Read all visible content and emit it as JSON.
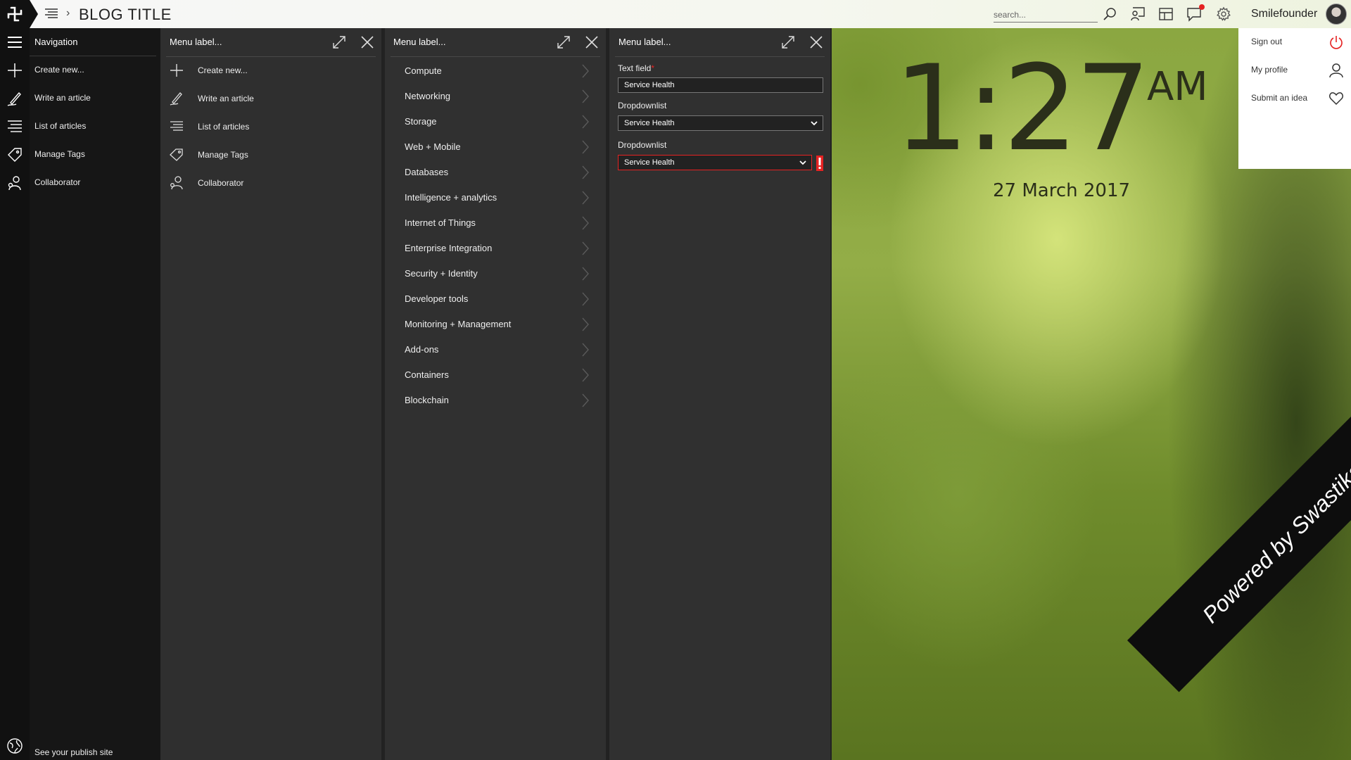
{
  "app": {
    "blog_title": "BLOG TITLE",
    "username": "Smilefounder"
  },
  "search": {
    "placeholder": "search..."
  },
  "colors": {
    "topbar_bg": "#f7f7f7",
    "rail_bg": "#111111",
    "panel_bg": "#303030",
    "error": "#e52222",
    "clock_text": "#2b2f1a"
  },
  "navigation": {
    "title": "Navigation",
    "items": [
      {
        "label": "Create new...",
        "icon": "plus-icon"
      },
      {
        "label": "Write an article",
        "icon": "pen-icon"
      },
      {
        "label": "List of articles",
        "icon": "list-icon"
      },
      {
        "label": "Manage Tags",
        "icon": "tag-icon"
      },
      {
        "label": "Collaborator",
        "icon": "collaborator-icon"
      }
    ],
    "publish_label": "See your publish site"
  },
  "panel1": {
    "title": "Menu label...",
    "items": [
      {
        "label": "Create new...",
        "icon": "plus-icon"
      },
      {
        "label": "Write an article",
        "icon": "pen-icon"
      },
      {
        "label": "List of articles",
        "icon": "list-icon"
      },
      {
        "label": "Manage Tags",
        "icon": "tag-icon"
      },
      {
        "label": "Collaborator",
        "icon": "collaborator-icon"
      }
    ]
  },
  "panel2": {
    "title": "Menu label...",
    "items": [
      {
        "label": "Compute"
      },
      {
        "label": "Networking"
      },
      {
        "label": "Storage"
      },
      {
        "label": "Web + Mobile"
      },
      {
        "label": "Databases"
      },
      {
        "label": "Intelligence + analytics"
      },
      {
        "label": "Internet of Things"
      },
      {
        "label": "Enterprise Integration"
      },
      {
        "label": "Security + Identity"
      },
      {
        "label": "Developer tools"
      },
      {
        "label": "Monitoring + Management"
      },
      {
        "label": "Add-ons"
      },
      {
        "label": "Containers"
      },
      {
        "label": "Blockchain"
      }
    ]
  },
  "panel3": {
    "title": "Menu label...",
    "text_field": {
      "label": "Text field",
      "required_mark": "*",
      "value": "Service Health"
    },
    "dropdown1": {
      "label": "Dropdownlist",
      "value": "Service Health"
    },
    "dropdown2": {
      "label": "Dropdownlist",
      "value": "Service Health",
      "state": "error"
    }
  },
  "clock": {
    "time": "1:27",
    "ampm": "AM",
    "date": "27 March 2017"
  },
  "user_menu": {
    "items": [
      {
        "label": "Sign out",
        "icon": "power-icon"
      },
      {
        "label": "My profile",
        "icon": "user-icon"
      },
      {
        "label": "Submit an idea",
        "icon": "heart-icon"
      }
    ]
  },
  "ribbon": {
    "text": "Powered by Swastika I/O"
  }
}
